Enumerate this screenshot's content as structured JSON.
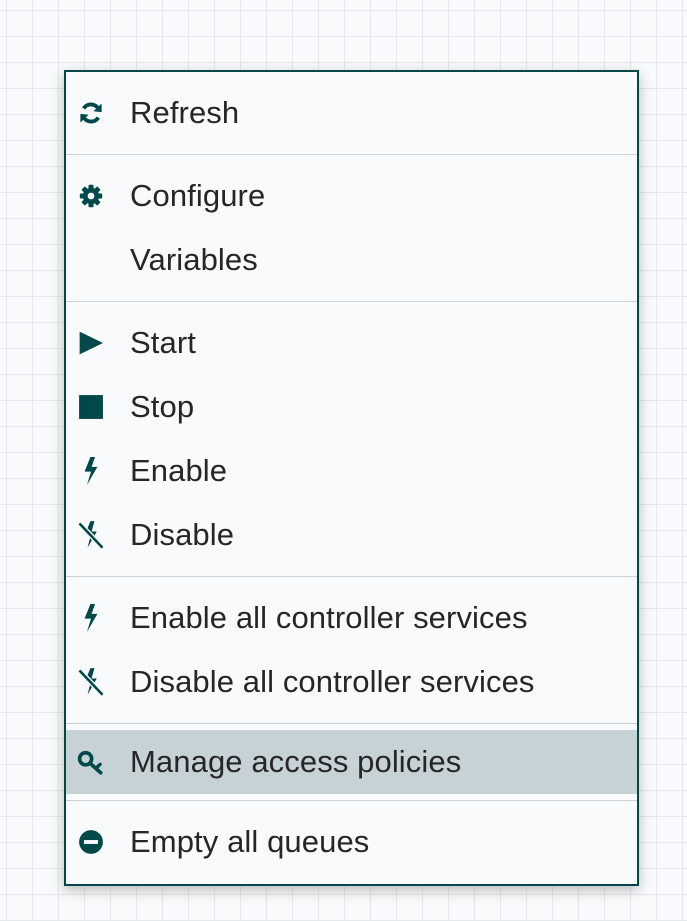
{
  "colors": {
    "accent": "#004849",
    "hover_background": "#c7d2d7",
    "menu_background": "#f9fafb",
    "text": "#262626",
    "grid_background": "#f9fafb"
  },
  "context_menu": {
    "groups": [
      [
        {
          "label": "Refresh",
          "icon": "refresh-icon"
        }
      ],
      [
        {
          "label": "Configure",
          "icon": "gear-icon"
        },
        {
          "label": "Variables",
          "icon": "none"
        }
      ],
      [
        {
          "label": "Start",
          "icon": "play-icon"
        },
        {
          "label": "Stop",
          "icon": "stop-icon"
        },
        {
          "label": "Enable",
          "icon": "bolt-icon"
        },
        {
          "label": "Disable",
          "icon": "bolt-disabled-icon"
        }
      ],
      [
        {
          "label": "Enable all controller services",
          "icon": "bolt-icon"
        },
        {
          "label": "Disable all controller services",
          "icon": "bolt-disabled-icon"
        }
      ],
      [
        {
          "label": "Manage access policies",
          "icon": "key-icon",
          "highlighted": true
        }
      ],
      [
        {
          "label": "Empty all queues",
          "icon": "minus-circle-icon"
        }
      ]
    ]
  }
}
